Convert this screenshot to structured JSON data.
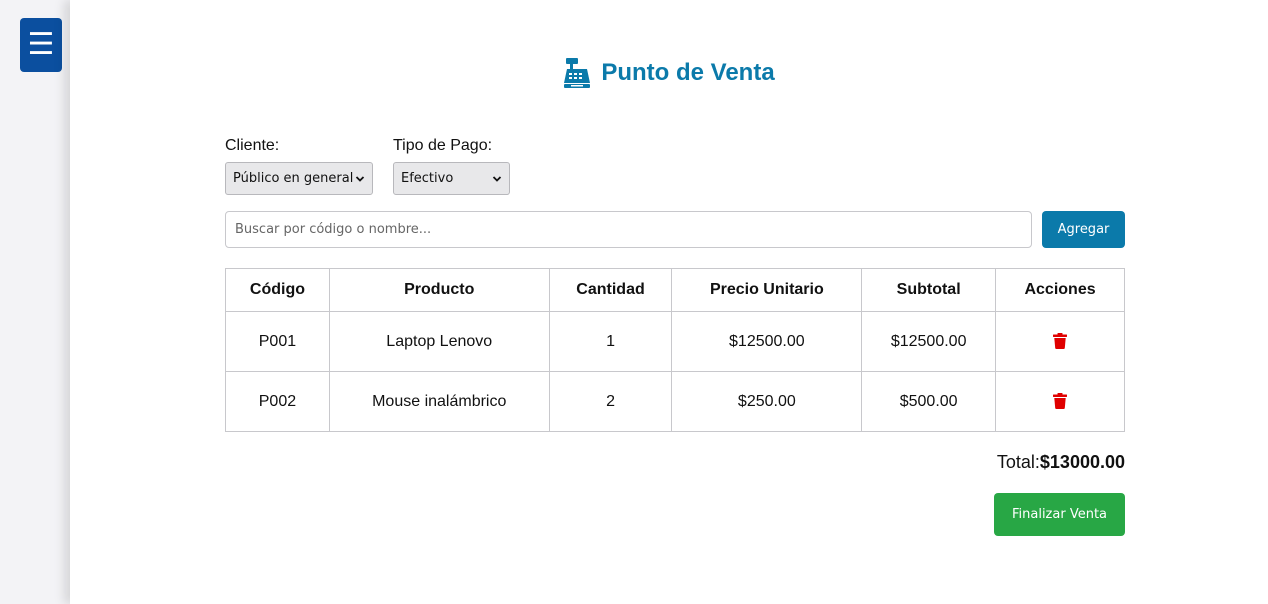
{
  "sidebar": {
    "menu_glyph": "☰",
    "menu_icon": "hamburger-menu-icon"
  },
  "header": {
    "title": "Punto de Venta",
    "icon": "cash-register-icon",
    "accent_color": "#0b7aaa"
  },
  "form": {
    "cliente_label": "Cliente:",
    "cliente_value": "Público en general",
    "pago_label": "Tipo de Pago:",
    "pago_value": "Efectivo",
    "search_placeholder": "Buscar por código o nombre...",
    "add_label": "Agregar"
  },
  "table": {
    "headers": [
      "Código",
      "Producto",
      "Cantidad",
      "Precio Unitario",
      "Subtotal",
      "Acciones"
    ],
    "rows": [
      {
        "codigo": "P001",
        "producto": "Laptop Lenovo",
        "cantidad": "1",
        "precio": "$12500.00",
        "subtotal": "$12500.00",
        "action_icon": "trash-icon"
      },
      {
        "codigo": "P002",
        "producto": "Mouse inalámbrico",
        "cantidad": "2",
        "precio": "$250.00",
        "subtotal": "$500.00",
        "action_icon": "trash-icon"
      }
    ]
  },
  "summary": {
    "total_label": "Total:",
    "total_value": "$13000.00"
  },
  "actions": {
    "finish_label": "Finalizar Venta",
    "finish_color": "#28a745",
    "delete_color": "#e00000"
  }
}
